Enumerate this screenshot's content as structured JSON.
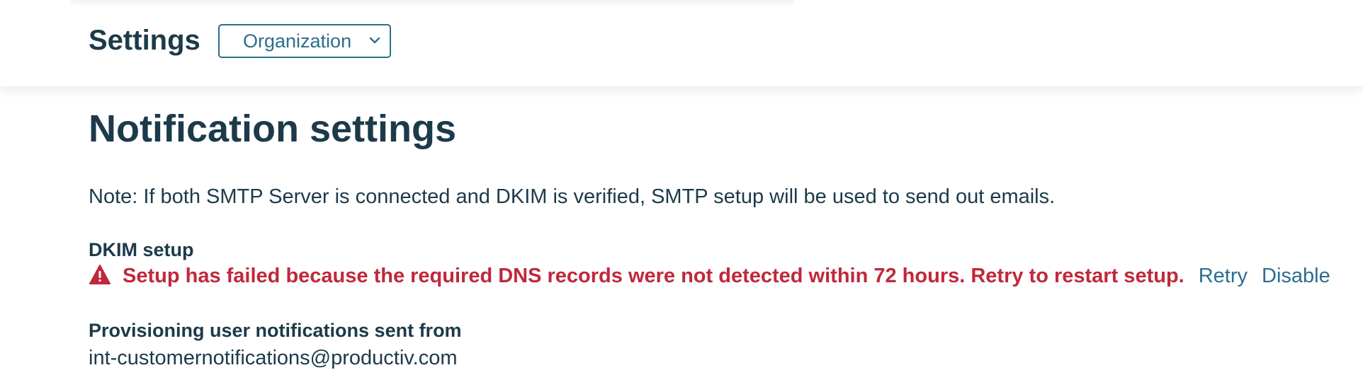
{
  "header": {
    "title": "Settings",
    "org_select": {
      "selected": "Organization"
    }
  },
  "main": {
    "page_title": "Notification settings",
    "note": "Note: If both SMTP Server is connected and DKIM is verified, SMTP setup will be used to send out emails.",
    "dkim": {
      "label": "DKIM setup",
      "error_message": "Setup has failed because the required DNS records were not detected within 72 hours. Retry to restart setup.",
      "retry_label": "Retry",
      "disable_label": "Disable"
    },
    "provisioning": {
      "label": "Provisioning user notifications sent from",
      "value": "int-customernotifications@productiv.com"
    }
  },
  "colors": {
    "primary_text": "#1c3a4a",
    "link": "#2c6e8f",
    "error": "#c0283c"
  },
  "icons": {
    "warning": "warning-triangle-icon",
    "dropdown": "chevron-down-icon"
  }
}
